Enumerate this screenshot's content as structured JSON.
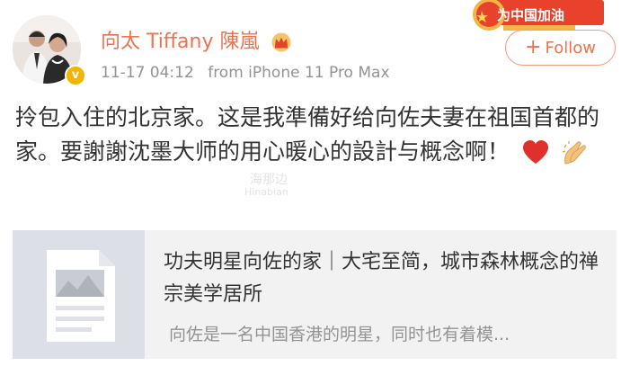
{
  "user": {
    "name": "向太 Tiffany 陳嵐",
    "verified_mark": "v"
  },
  "meta": {
    "time": "11-17 04:12",
    "source": "from iPhone 11 Pro Max"
  },
  "badge": {
    "label": "为中国加油"
  },
  "follow_button": {
    "plus": "+",
    "label": "Follow"
  },
  "post": {
    "text": "拎包入住的北京家。这是我準備好给向佐夫妻在祖国首都的家。要謝謝沈墨大师的用心暖心的設計与概念啊！"
  },
  "watermark": {
    "cn": "海那边",
    "en": "Hinabian"
  },
  "link_card": {
    "title": "功夫明星向佐的家｜大宅至简，城市森林概念的禅宗美学居所",
    "description": "向佐是一名中国香港的明星，同时也有着模..."
  },
  "colors": {
    "accent": "#eb7350",
    "meta_gray": "#939393",
    "card_bg": "#f2f2f2"
  },
  "icons": [
    "crown-icon",
    "verified-icon",
    "heart-icon",
    "clap-hands-icon",
    "document-thumbnail-icon"
  ]
}
